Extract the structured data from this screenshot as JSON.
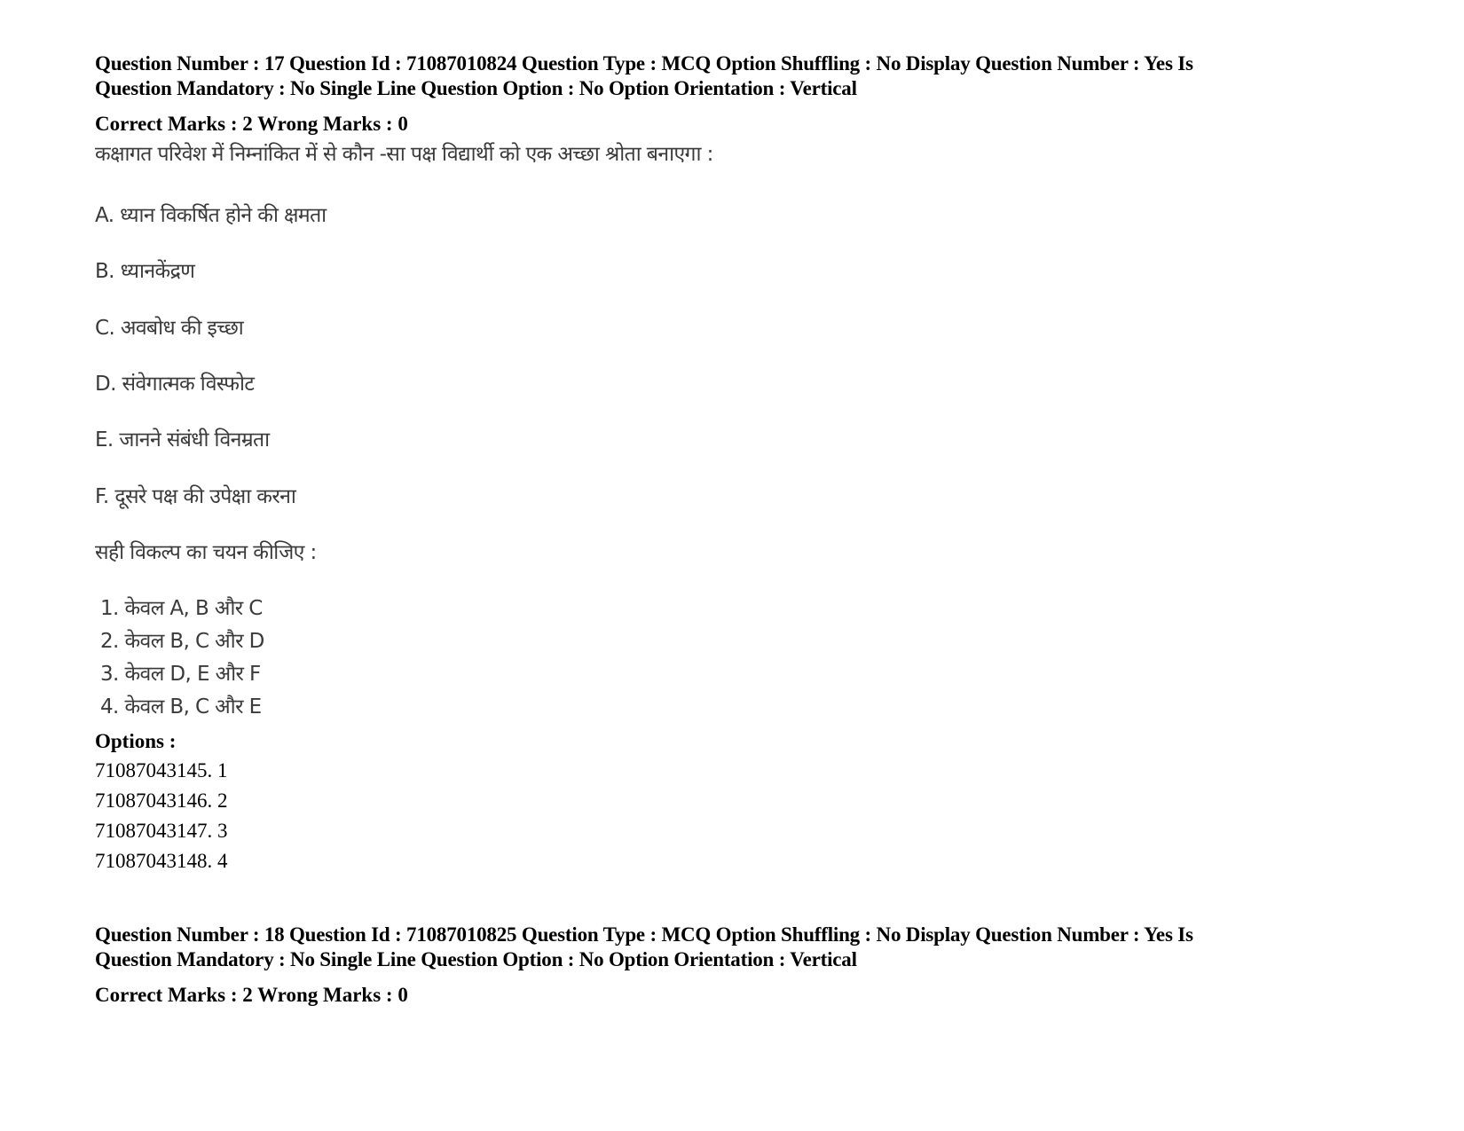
{
  "questions": [
    {
      "header_line1": "Question Number : 17 Question Id : 71087010824 Question Type : MCQ Option Shuffling : No Display Question Number : Yes Is",
      "header_line2": "Question Mandatory : No Single Line Question Option : No Option Orientation : Vertical",
      "marks": "Correct Marks : 2 Wrong Marks : 0",
      "stem": "कक्षागत परिवेश में निम्नांकित में से कौन -सा पक्ष विद्यार्थी को एक अच्छा श्रोता बनाएगा :",
      "statements": [
        "A. ध्यान विकर्षित होने की क्षमता",
        "B. ध्यानकेंद्रण",
        "C. अवबोध की इच्छा",
        "D. संवेगात्मक विस्फोट",
        "E. जानने संबंधी विनम्रता",
        "F. दूसरे पक्ष की उपेक्षा करना"
      ],
      "instruction": "सही विकल्प का चयन कीजिए :",
      "choices": [
        "1. केवल A, B और C",
        "2. केवल B, C और D",
        "3. केवल D, E और F",
        "4. केवल B, C और E"
      ],
      "options_label": "Options :",
      "options": [
        "71087043145. 1",
        "71087043146. 2",
        "71087043147. 3",
        "71087043148. 4"
      ]
    },
    {
      "header_line1": "Question Number : 18 Question Id : 71087010825 Question Type : MCQ Option Shuffling : No Display Question Number : Yes Is",
      "header_line2": "Question Mandatory : No Single Line Question Option : No Option Orientation : Vertical",
      "marks": "Correct Marks : 2 Wrong Marks : 0"
    }
  ]
}
